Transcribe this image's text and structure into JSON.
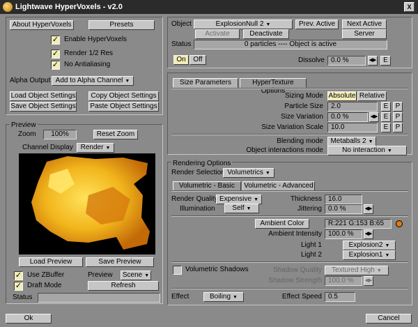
{
  "window": {
    "title": "Lightwave HyperVoxels - v2.0",
    "close_label": "X"
  },
  "top_left": {
    "about_label": "About HyperVoxels",
    "presets_label": "Presets",
    "enable_label": "Enable HyperVoxels",
    "render_half_label": "Render 1/2 Res",
    "no_antialias_label": "No Antialiasing",
    "alpha_output_label": "Alpha Output",
    "alpha_output_value": "Add to Alpha Channel",
    "load_obj_label": "Load Object Settings",
    "copy_obj_label": "Copy Object Settings",
    "save_obj_label": "Save Object Settings",
    "paste_obj_label": "Paste Object Settings",
    "check_mark": "✓"
  },
  "preview": {
    "section_label": "Preview",
    "zoom_label": "Zoom",
    "zoom_value": "100%",
    "reset_zoom_label": "Reset Zoom",
    "channel_display_label": "Channel Display",
    "channel_display_value": "Render",
    "load_preview_label": "Load Preview",
    "save_preview_label": "Save Preview",
    "use_zbuffer_label": "Use ZBuffer",
    "preview_label": "Preview",
    "preview_value": "Scene",
    "draft_mode_label": "Draft Mode",
    "refresh_label": "Refresh",
    "status_label": "Status"
  },
  "object": {
    "object_label": "Object",
    "object_value": "ExplosionNull 2",
    "prev_active_label": "Prev. Active",
    "next_active_label": "Next Active",
    "activate_label": "Activate",
    "deactivate_label": "Deactivate",
    "server_label": "Server",
    "status_label": "Status",
    "status_value": "0 particles ---- Object is active",
    "on_label": "On",
    "off_label": "Off",
    "dissolve_label": "Dissolve",
    "dissolve_value": "0.0 %",
    "e_label": "E",
    "p_label": "P"
  },
  "tabs1": {
    "size_params": "Size Parameters",
    "hypertexture": "HyperTexture Options"
  },
  "size": {
    "sizing_mode_label": "Sizing Mode",
    "absolute_label": "Absolute",
    "relative_label": "Relative",
    "particle_size_label": "Particle Size",
    "particle_size_value": "2.0",
    "size_variation_label": "Size Variation",
    "size_variation_value": "0.0 %",
    "size_variation_scale_label": "Size Variation Scale",
    "size_variation_scale_value": "10.0",
    "blending_mode_label": "Blending mode",
    "blending_mode_value": "Metaballs 2",
    "interactions_label": "Object interactions mode",
    "interactions_value": "No interaction"
  },
  "rendering": {
    "section_label": "Rendering Options",
    "render_selection_label": "Render Selection",
    "render_selection_value": "Volumetrics",
    "tab_basic": "Volumetric - Basic",
    "tab_advanced": "Volumetric - Advanced",
    "render_quality_label": "Render Quality",
    "render_quality_value": "Expensive",
    "thickness_label": "Thickness",
    "thickness_value": "16.0",
    "illumination_label": "Illumination",
    "illumination_value": "Self",
    "jittering_label": "Jittering",
    "jittering_value": "0.0 %",
    "ambient_color_label": "Ambient Color",
    "ambient_color_value": "R:221  G:153  B:65",
    "ambient_color_hex": "#dd9941",
    "ambient_intensity_label": "Ambient Intensity",
    "ambient_intensity_value": "100.0 %",
    "light1_label": "Light 1",
    "light1_value": "Explosion2",
    "light2_label": "Light 2",
    "light2_value": "Explosion1",
    "vol_shadows_label": "Volumetric Shadows",
    "shadow_quality_label": "Shadow Quality",
    "shadow_quality_value": "Textured High",
    "shadow_strength_label": "Shadow Strength",
    "shadow_strength_value": "100.0 %",
    "effect_label": "Effect",
    "effect_value": "Boiling",
    "effect_speed_label": "Effect Speed",
    "effect_speed_value": "0.5"
  },
  "footer": {
    "ok_label": "Ok",
    "cancel_label": "Cancel"
  }
}
